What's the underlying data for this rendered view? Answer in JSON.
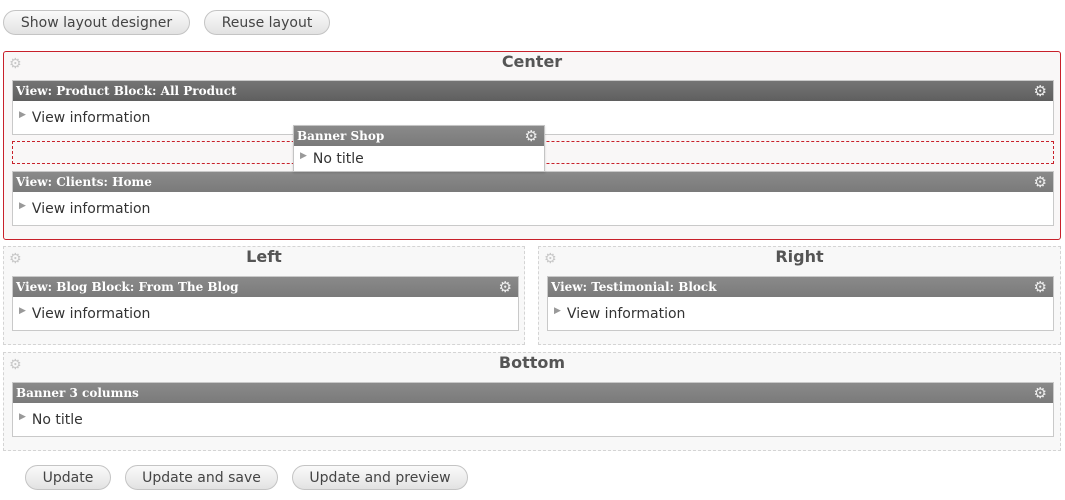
{
  "toolbar": {
    "show_layout_designer": "Show layout designer",
    "reuse_layout": "Reuse layout"
  },
  "regions": {
    "center": {
      "title": "Center",
      "panes": [
        {
          "title": "View: Product Block: All Product",
          "body": "View information"
        },
        {
          "title": "View: Clients: Home",
          "body": "View information"
        }
      ]
    },
    "left": {
      "title": "Left",
      "panes": [
        {
          "title": "View: Blog Block: From The Blog",
          "body": "View information"
        }
      ]
    },
    "right": {
      "title": "Right",
      "panes": [
        {
          "title": "View: Testimonial: Block",
          "body": "View information"
        }
      ]
    },
    "bottom": {
      "title": "Bottom",
      "panes": [
        {
          "title": "Banner 3 columns",
          "body": "No title"
        }
      ]
    }
  },
  "dragging": {
    "title": "Banner Shop",
    "body": "No title"
  },
  "footer": {
    "update": "Update",
    "update_and_save": "Update and save",
    "update_and_preview": "Update and preview"
  },
  "icons": {
    "gear": "gear-icon",
    "expand": "triangle-right-icon"
  },
  "colors": {
    "active_border": "#c8202a",
    "pane_header": "#7a7a7a"
  }
}
